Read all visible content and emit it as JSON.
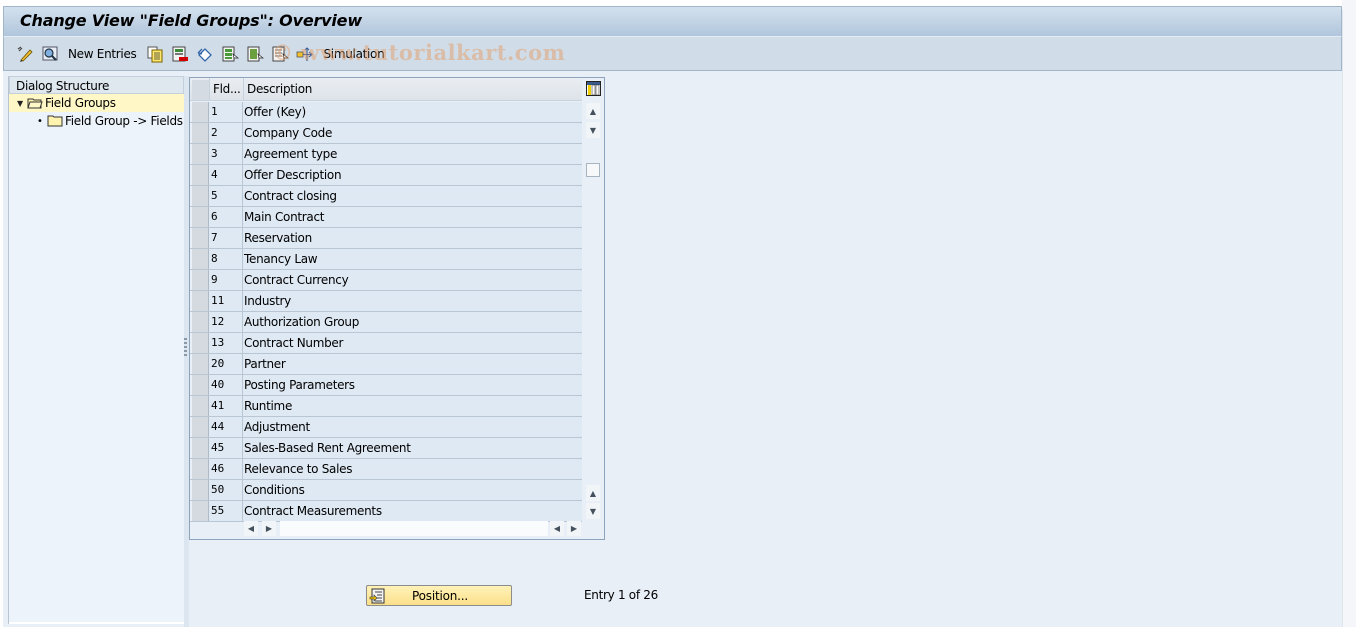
{
  "window": {
    "title": "Change View \"Field Groups\": Overview"
  },
  "toolbar": {
    "items": [
      {
        "icon": "display-change-icon",
        "label": ""
      },
      {
        "icon": "find-icon",
        "label": ""
      },
      {
        "icon": "",
        "label": "New Entries"
      },
      {
        "icon": "copy-as-icon",
        "label": ""
      },
      {
        "icon": "delete-icon",
        "label": ""
      },
      {
        "icon": "undo-change-icon",
        "label": ""
      },
      {
        "icon": "select-all-icon",
        "label": ""
      },
      {
        "icon": "select-block-icon",
        "label": ""
      },
      {
        "icon": "deselect-all-icon",
        "label": ""
      },
      {
        "icon": "transport-icon",
        "label": ""
      }
    ],
    "new_entries_label": "New Entries",
    "simulation_label": "Simulation",
    "watermark": "© www.tutorialkart.com"
  },
  "dialog_structure": {
    "header": "Dialog Structure",
    "nodes": [
      {
        "label": "Field Groups",
        "level": 0,
        "expanded": true,
        "selected": true
      },
      {
        "label": "Field Group -> Fields",
        "level": 1,
        "expanded": false,
        "selected": false
      }
    ]
  },
  "table": {
    "columns": [
      "Fld...",
      "Description"
    ],
    "rows": [
      {
        "fld": "1",
        "description": "Offer (Key)"
      },
      {
        "fld": "2",
        "description": "Company Code"
      },
      {
        "fld": "3",
        "description": "Agreement type"
      },
      {
        "fld": "4",
        "description": "Offer Description"
      },
      {
        "fld": "5",
        "description": "Contract closing"
      },
      {
        "fld": "6",
        "description": "Main Contract"
      },
      {
        "fld": "7",
        "description": "Reservation"
      },
      {
        "fld": "8",
        "description": "Tenancy Law"
      },
      {
        "fld": "9",
        "description": "Contract Currency"
      },
      {
        "fld": "11",
        "description": "Industry"
      },
      {
        "fld": "12",
        "description": "Authorization Group"
      },
      {
        "fld": "13",
        "description": "Contract Number"
      },
      {
        "fld": "20",
        "description": "Partner"
      },
      {
        "fld": "40",
        "description": "Posting Parameters"
      },
      {
        "fld": "41",
        "description": "Runtime"
      },
      {
        "fld": "44",
        "description": "Adjustment"
      },
      {
        "fld": "45",
        "description": "Sales-Based Rent Agreement"
      },
      {
        "fld": "46",
        "description": "Relevance to Sales"
      },
      {
        "fld": "50",
        "description": "Conditions"
      },
      {
        "fld": "55",
        "description": "Contract Measurements"
      }
    ]
  },
  "footer": {
    "position_label": "Position...",
    "entry_info": "Entry 1 of 26"
  },
  "colors": {
    "selected_node": "#fff8c6",
    "row_bg": "#dfe9f4",
    "button_bg": "#fbe08a"
  }
}
